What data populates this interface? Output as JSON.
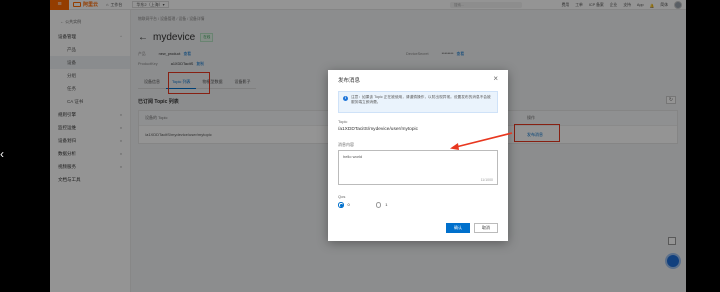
{
  "colors": {
    "brand": "#ff6a00",
    "primary": "#0070cc",
    "annotation_red": "#e8371f"
  },
  "topbar": {
    "logo_text": "阿里云",
    "workbench": "工作台",
    "region": "华东2（上海）",
    "search_placeholder": "搜索...",
    "right_items": [
      "费用",
      "工单",
      "ICP 备案",
      "企业",
      "支持",
      "App",
      "简体"
    ]
  },
  "sidebar": {
    "back": "← 公共实例",
    "items": [
      {
        "label": "设备管理",
        "chevron": "^"
      },
      {
        "label": "产品"
      },
      {
        "label": "设备"
      },
      {
        "label": "分组"
      },
      {
        "label": "任务"
      },
      {
        "label": "CA 证书"
      },
      {
        "label": "规则引擎",
        "chevron": "v"
      },
      {
        "label": "监控运维",
        "chevron": "v"
      },
      {
        "label": "设备划归",
        "chevron": "v"
      },
      {
        "label": "数据分析",
        "chevron": "v"
      },
      {
        "label": "视频服务",
        "chevron": "v"
      },
      {
        "label": "文档与工具"
      }
    ]
  },
  "page": {
    "breadcrumb": "物联网平台  /  设备管理  /  设备  /  设备详情",
    "title": "mydevice",
    "status": "在线",
    "product_label": "产品",
    "product_value": "new_product",
    "product_link": "查看",
    "productkey_label": "ProductKey",
    "productkey_value": "a1XDDTacitS",
    "productkey_link": "复制",
    "devicesecret_label": "DeviceSecret",
    "devicesecret_value": "********",
    "devicesecret_link": "查看"
  },
  "tabs": [
    "设备信息",
    "Topic 列表",
    "物模型数据",
    "设备影子"
  ],
  "section_title": "已订阅 Topic 列表",
  "table": {
    "headers": [
      "设备的 Topic",
      "操作"
    ],
    "rows": [
      {
        "topic": "/a1XDDTacitS/mydevice/user/mytopic",
        "op": "发布消息"
      }
    ]
  },
  "modal": {
    "title": "发布消息",
    "notice": "注意：如果该 Topic 正在被使用，请谨慎操作，以防出现异常。设置发布的消息不会被服务端立即消费。",
    "topic_label": "Topic",
    "topic_value": "/a1XDDTacitS/mydevice/user/mytopic",
    "message_label": "消息内容",
    "message_value": "hello world",
    "counter": "11/1000",
    "qos_label": "Qos",
    "qos_options": [
      "0",
      "1"
    ],
    "qos_selected": "0",
    "ok": "确认",
    "cancel": "取消"
  }
}
